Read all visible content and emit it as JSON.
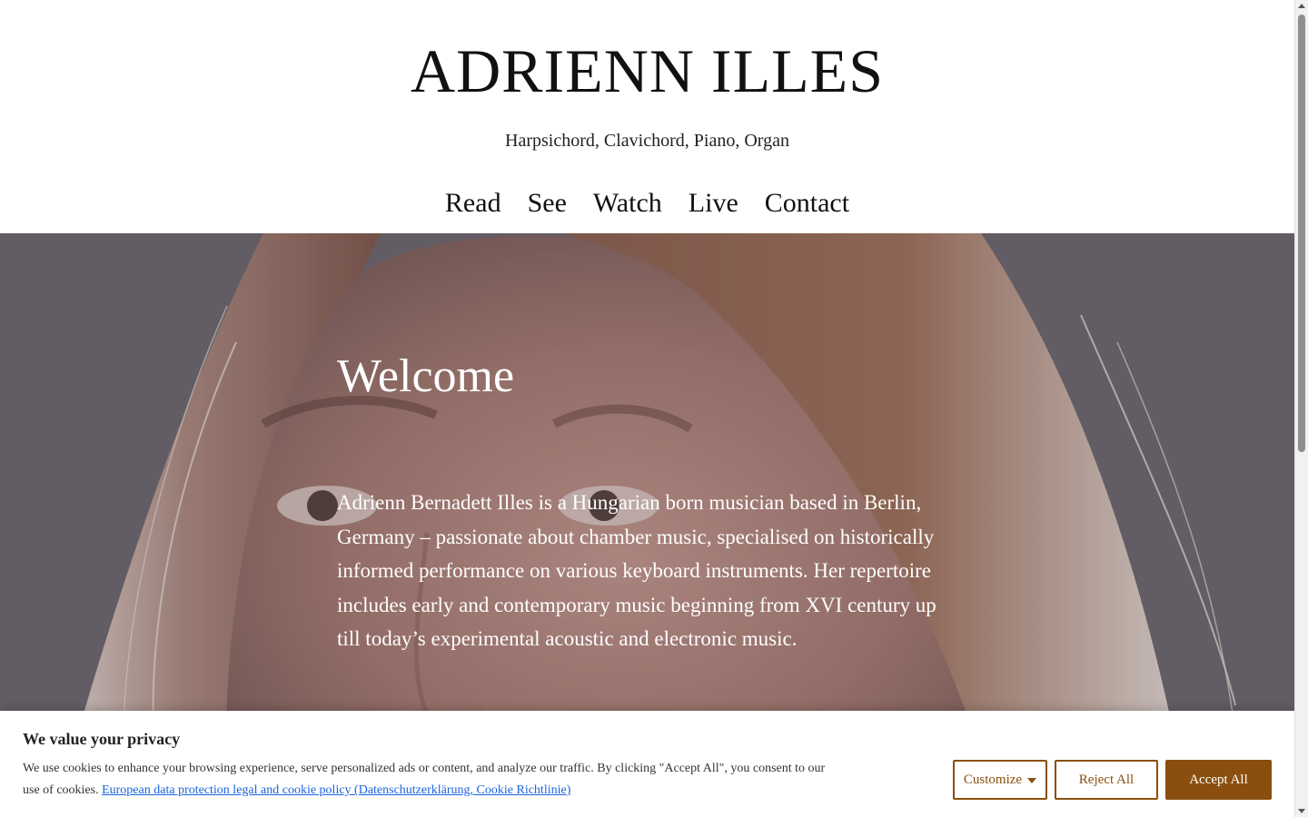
{
  "header": {
    "title": "ADRIENN ILLES",
    "subtitle": "Harpsichord, Clavichord, Piano, Organ"
  },
  "nav": {
    "items": [
      "Read",
      "See",
      "Watch",
      "Live",
      "Contact"
    ]
  },
  "hero": {
    "heading": "Welcome",
    "text": "Adrienn Bernadett Illes is a Hungarian born musician based in Berlin, Germany – passionate about chamber music, specialised on historically informed performance on various keyboard instruments. Her repertoire includes early and contemporary music beginning from XVI century up till today’s experimental acoustic and electronic music."
  },
  "cookie": {
    "title": "We value your privacy",
    "text": "We use cookies to enhance your browsing experience, serve personalized ads or content, and analyze our traffic. By clicking \"Accept All\", you consent to our use of cookies.",
    "link": "European data protection legal and cookie policy (Datenschutzerklärung, Cookie Richtlinie)",
    "buttons": {
      "customize": "Customize",
      "reject": "Reject All",
      "accept": "Accept All"
    }
  },
  "colors": {
    "accent": "#8a4f0e",
    "link": "#1863dc",
    "hero_overlay": "#6a6567"
  },
  "icons": {
    "customize_caret": "caret-down-icon"
  }
}
